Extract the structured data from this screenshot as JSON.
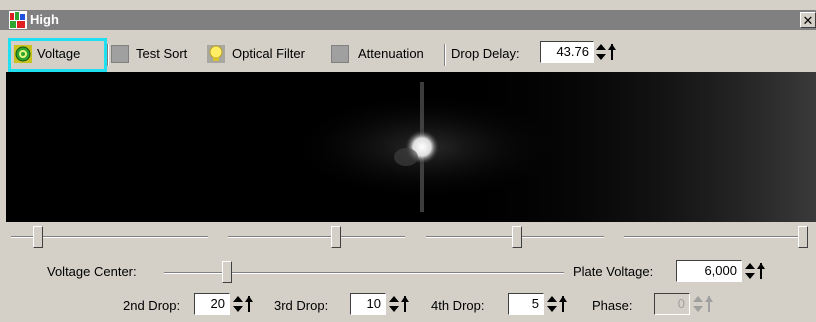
{
  "window": {
    "title": "High",
    "close_glyph": "✕"
  },
  "toolbar": {
    "voltage": {
      "label": "Voltage",
      "icon": "voltage-indicator-icon",
      "active": true
    },
    "test_sort": {
      "label": "Test Sort",
      "icon": "test-sort-icon",
      "active": false
    },
    "optical_filter": {
      "label": "Optical Filter",
      "icon": "lightbulb-icon",
      "active": true
    },
    "attenuation": {
      "label": "Attenuation",
      "icon": "attenuation-icon",
      "active": false
    },
    "drop_delay": {
      "label": "Drop Delay:",
      "value": "43.76"
    }
  },
  "sliders_row": {
    "count": 4
  },
  "voltage_center": {
    "label": "Voltage Center:"
  },
  "plate_voltage": {
    "label": "Plate Voltage:",
    "value": "6,000"
  },
  "drops": {
    "second": {
      "label": "2nd Drop:",
      "value": "20"
    },
    "third": {
      "label": "3rd Drop:",
      "value": "10"
    },
    "fourth": {
      "label": "4th Drop:",
      "value": "5"
    },
    "phase": {
      "label": "Phase:",
      "value": "0",
      "disabled": true
    }
  },
  "colors": {
    "highlight": "#1ee0f0",
    "accent_green": "#2ea52e",
    "accent_yellow": "#ffee66"
  }
}
